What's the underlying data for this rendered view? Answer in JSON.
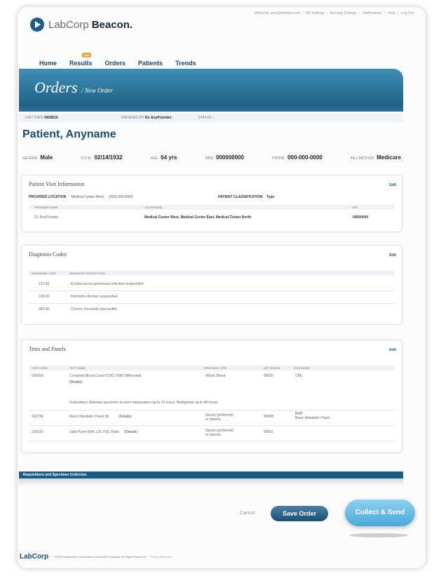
{
  "header": {
    "logo": {
      "icon": "labcorp-arrow-icon",
      "brand_light": "LabCorp",
      "brand_bold": "Beacon."
    },
    "top_links": [
      "Welcome user@domain.com",
      "My Settings",
      "Account Settings",
      "Notifications",
      "Help",
      "Log Out"
    ]
  },
  "nav": {
    "home": "Home",
    "results": "Results",
    "results_badge": "123",
    "orders": "Orders",
    "patients": "Patients",
    "trends": "Trends"
  },
  "banner": {
    "title": "Orders",
    "subtitle": "/ New Order"
  },
  "visit": {
    "visit_date_label": "VISIT DATE",
    "visit_date": "04/28/10",
    "ordered_by_label": "ORDERED BY",
    "ordered_by": "Dr. AnyProvider",
    "status_label": "STATUS",
    "status": "--"
  },
  "patient": {
    "name": "Patient, Anyname",
    "gender_label": "GENDER",
    "gender": "Male",
    "dob_label": "D.O.B.",
    "dob": "02/14/1932",
    "age_label": "AGE",
    "age": "64 yrs",
    "mrn_label": "MRN",
    "mrn": "000000000",
    "phone_label": "PHONE",
    "phone": "000-000-0000",
    "bill_label": "BILL METHOD",
    "bill": "Medicare"
  },
  "visit_info": {
    "title": "Patient Visit Information",
    "edit": "Edit",
    "provider_location_label": "PROVIDER LOCATION",
    "provider_location": "Medical Center West",
    "provider_phone": "(000) 000-0000",
    "classification_label": "PATIENT CLASSIFICATION",
    "classification": "Type",
    "col_provider": "PROVIDER NAME",
    "col_locations": "LOCATION(S)",
    "col_npi": "NPI",
    "provider_name": "Dr. AnyProvider",
    "locations": "Medical Center West, Medical Center East, Medical Center North",
    "npi": "00000000"
  },
  "diagnosis": {
    "title": "Diagnosis Codes",
    "edit": "Edit",
    "col_code": "DIAGNOSIS CODE",
    "col_desc": "DIAGNOSIS DESCRIPTION",
    "rows": [
      {
        "code": "122.40",
        "desc": "Echinococcus granulosus infection unspecified"
      },
      {
        "code": "128.00",
        "desc": "Helminth infection unspecified"
      },
      {
        "code": "393.00",
        "desc": "Chronic rheumatic pericarditis"
      }
    ]
  },
  "tests": {
    "title": "Tests and Panels",
    "edit": "Edit",
    "col_code": "TEST CODE",
    "col_name": "TEST NAME",
    "col_specimen": "SPECIMEN TYPE",
    "col_cpt": "CPT CODES",
    "col_syn": "SYNONYMS",
    "rows": [
      {
        "code": "005009",
        "name": "Complete Blood Count (CBC) With Differential",
        "details": "(Details)",
        "specimen": "Whole Blood",
        "specimen2": "",
        "cpt": "85025",
        "syn": "CBC",
        "syn2": ""
      },
      {
        "code": "322758",
        "name": "Basic Metabolic Panel (8)",
        "details": "(Details)",
        "specimen": "Serum (preferred)",
        "specimen2": "or plasma",
        "cpt": "80048",
        "syn": "BMP",
        "syn2": "Basic Metabolic Panel"
      },
      {
        "code": "235010",
        "name": "Lipid Panel With LDL:HDL Ratio",
        "details": "(Details)",
        "specimen": "Serum (preferred)",
        "specimen2": "or plasma",
        "cpt": "80061",
        "syn": "",
        "syn2": ""
      }
    ],
    "instructions": "Instructions: Maintain specimen at room temperature up to 24 hours. Refrigerate up to 48 hours."
  },
  "requisitions": {
    "label": "Requisitions and Specimen Collection"
  },
  "actions": {
    "cancel": "Cancel",
    "save": "Save Order",
    "send": "Collect & Send"
  },
  "footer": {
    "logo": "LabCorp",
    "copyright": "©2010 Laboratory Corporation of America® Holdings. All Rights Reserved.",
    "privacy": "Privacy Statement"
  },
  "colors": {
    "primary": "#1d4e72",
    "accent": "#4aa8d8",
    "badge": "#e7a84a"
  }
}
